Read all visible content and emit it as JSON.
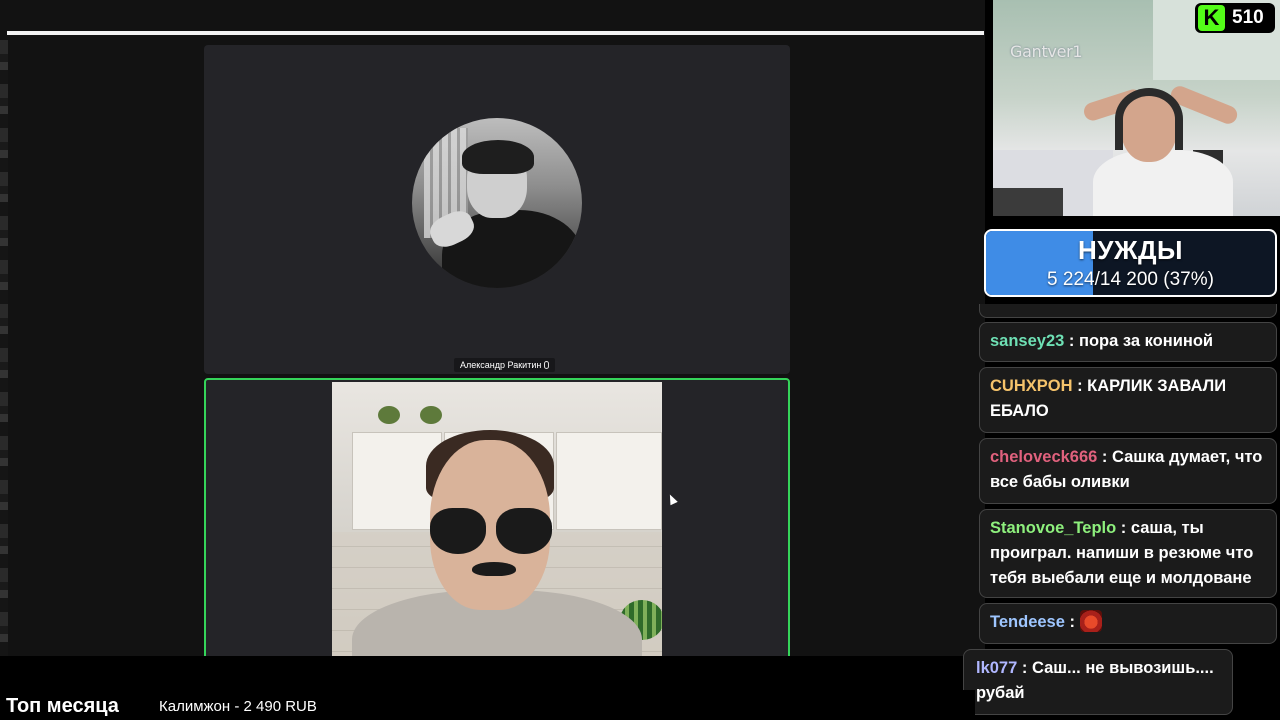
{
  "meeting": {
    "participant_name": "Александр Ракитин"
  },
  "overlay": {
    "streamer_name": "Gantver1",
    "platform_logo": "K",
    "viewer_count": "510",
    "icons": [
      "kick-logo-icon",
      "microphone-icon",
      "cursor-icon"
    ]
  },
  "goal": {
    "title": "НУЖДЫ",
    "progress_text": "5 224/14 200 (37%)",
    "fraction": 0.37,
    "fill_color": "#3f8ce6"
  },
  "chat": {
    "messages": [
      {
        "user": "sansey23",
        "color": "#6ee0b4",
        "text": " : пора за кониной"
      },
      {
        "user": "CUHXPOH",
        "color": "#f5c36b",
        "text": " : КАРЛИК ЗАВАЛИ ЕБАЛО"
      },
      {
        "user": "cheloveck666",
        "color": "#e0617d",
        "text": " : Сашка думает, что все бабы оливки"
      },
      {
        "user": "Stanovoe_Teplo",
        "color": "#8ef07d",
        "text": " : саша, ты проиграл. напиши в резюме что тебя выебали еще и молдоване"
      },
      {
        "user": "Tendeese",
        "color": "#9ec6ff",
        "text": " : ",
        "emote": "emote-icon"
      },
      {
        "user": "lk077",
        "color": "#b0b7ff",
        "text": " : Саш... не вывозишь....",
        "line2": "рубай"
      }
    ]
  },
  "bottom": {
    "top_month_label": "Топ месяца",
    "top_donor": "Калимжон - 2 490 RUB"
  }
}
